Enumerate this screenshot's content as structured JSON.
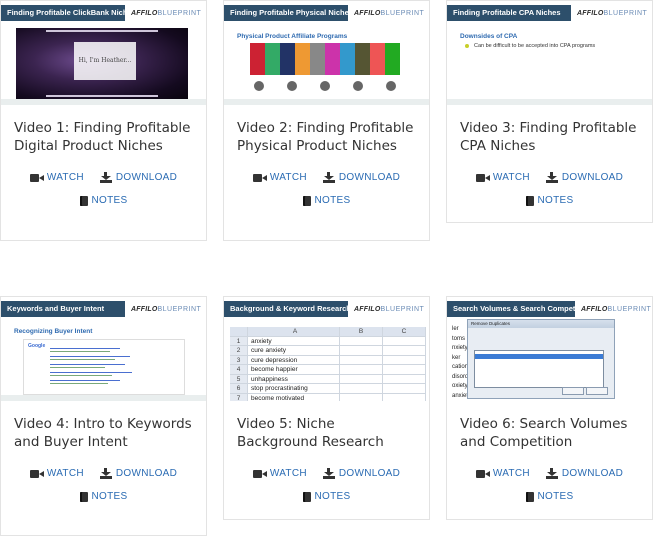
{
  "actions": {
    "watch": "WATCH",
    "download": "DOWNLOAD",
    "notes": "NOTES"
  },
  "logo": {
    "word": "AFFILO",
    "suffix": "BLUEPRINT"
  },
  "videos": [
    {
      "title": "Video 1: Finding Profitable Digital Product Niches",
      "thumb_title": "Finding Profitable ClickBank Niches",
      "thumb_text": "Hi, I'm Heather..."
    },
    {
      "title": "Video 2: Finding Profitable Physical Product Niches",
      "thumb_title": "Finding Profitable Physical Niches",
      "thumb_text": "Physical Product Affiliate Programs"
    },
    {
      "title": "Video 3: Finding Profitable CPA Niches",
      "thumb_title": "Finding Profitable CPA Niches",
      "thumb_text": "Downsides of CPA",
      "thumb_bullet": "Can be difficult to be accepted into CPA programs"
    },
    {
      "title": "Video 4: Intro to Keywords and Buyer Intent",
      "thumb_title": "Keywords and Buyer Intent",
      "thumb_text": "Recognizing Buyer Intent",
      "thumb_logo": "Google"
    },
    {
      "title": "Video 5: Niche Background Research",
      "thumb_title": "Background & Keyword Research",
      "sheet_headers": [
        "",
        "A",
        "B",
        "C"
      ],
      "sheet_rows": [
        [
          "1",
          "anxiety"
        ],
        [
          "2",
          "cure anxiety"
        ],
        [
          "3",
          "cure depression"
        ],
        [
          "4",
          "become happier"
        ],
        [
          "5",
          "unhappiness"
        ],
        [
          "6",
          "stop procrastinating"
        ],
        [
          "7",
          "become motivated"
        ]
      ]
    },
    {
      "title": "Video 6: Search Volumes and Competition",
      "thumb_title": "Search Volumes & Search Competition",
      "dialog_title": "Remove Duplicates",
      "col_text": [
        "ler",
        "toms",
        "nxiety m",
        "ker",
        "cation",
        "disorde",
        "oxiety",
        "anxiety"
      ]
    }
  ]
}
